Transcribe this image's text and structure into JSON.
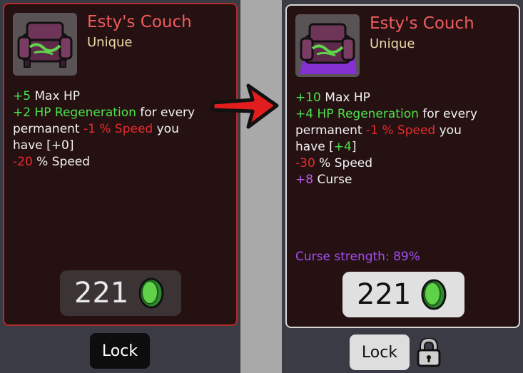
{
  "left_card": {
    "title": "Esty's Couch",
    "rarity": "Unique",
    "lines": {
      "l1_val": "+5",
      "l1_text": " Max HP",
      "l2_val": "+2 HP Regeneration",
      "l2_text": " for every",
      "l3_a": "permanent ",
      "l3_val": "-1 % Speed",
      "l3_b": " you",
      "l4_a": "have [",
      "l4_val": "+0",
      "l4_b": "]",
      "l5_val": "-20",
      "l5_text": " % Speed"
    },
    "price": "221",
    "lock_label": "Lock"
  },
  "right_card": {
    "title": "Esty's Couch",
    "rarity": "Unique",
    "lines": {
      "l1_val": "+10",
      "l1_text": " Max HP",
      "l2_val": "+4 HP Regeneration",
      "l2_text": " for every",
      "l3_a": "permanent ",
      "l3_val": "-1 % Speed",
      "l3_b": " you",
      "l4_a": "have [",
      "l4_val": "+4",
      "l4_b": "]",
      "l5_val": "-30",
      "l5_text": " % Speed",
      "l6_val": "+8",
      "l6_text": " Curse"
    },
    "curse_strength": "Curse strength:  89%",
    "price": "221",
    "lock_label": "Lock"
  },
  "colors": {
    "title": "#ef5b5b",
    "rarity": "#ecd9a8",
    "positive": "#4be34b",
    "negative": "#e82b2b",
    "curse": "#c05cf0",
    "card_bg": "#261112"
  },
  "icons": {
    "item": "couch-icon",
    "currency": "green-coin-icon",
    "arrow": "red-arrow-icon",
    "lock": "padlock-icon"
  }
}
